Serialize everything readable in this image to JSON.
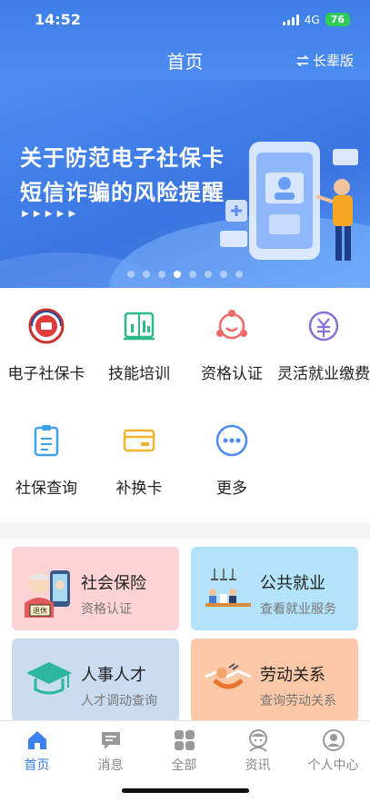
{
  "status": {
    "time": "14:52",
    "network": "4G",
    "battery": "76"
  },
  "header": {
    "title": "首页",
    "elder_mode_label": "长辈版",
    "elder_mode_icon": "swap-arrows-icon"
  },
  "banner": {
    "line1": "关于防范电子社保卡",
    "line2": "短信诈骗的风险提醒",
    "arrows": "▶ ▶ ▶ ▶ ▶",
    "slide_count": 8,
    "active_slide": 4
  },
  "services": [
    {
      "label": "电子社保卡",
      "icon": "social-security-seal-icon"
    },
    {
      "label": "技能培训",
      "icon": "book-chart-icon"
    },
    {
      "label": "资格认证",
      "icon": "face-verify-icon"
    },
    {
      "label": "灵活就业缴费",
      "icon": "yuan-coin-icon"
    },
    {
      "label": "社保查询",
      "icon": "clipboard-icon"
    },
    {
      "label": "补换卡",
      "icon": "card-icon"
    },
    {
      "label": "更多",
      "icon": "more-dots-icon"
    }
  ],
  "cards": [
    {
      "title": "社会保险",
      "subtitle": "资格认证",
      "badge": "退休",
      "color": "#fdd3d6"
    },
    {
      "title": "公共就业",
      "subtitle": "查看就业服务",
      "color": "#b3e3f9"
    },
    {
      "title": "人事人才",
      "subtitle": "人才调动查询",
      "color": "#c9dcf0"
    },
    {
      "title": "劳动关系",
      "subtitle": "查询劳动关系",
      "color": "#fcc8a8"
    }
  ],
  "tabs": [
    {
      "label": "首页",
      "icon": "home-icon",
      "active": true
    },
    {
      "label": "消息",
      "icon": "message-icon"
    },
    {
      "label": "全部",
      "icon": "grid-icon"
    },
    {
      "label": "资讯",
      "icon": "news-icon"
    },
    {
      "label": "个人中心",
      "icon": "profile-icon"
    }
  ],
  "colors": {
    "brand": "#3b82f0",
    "header": "#4d8cf0"
  }
}
